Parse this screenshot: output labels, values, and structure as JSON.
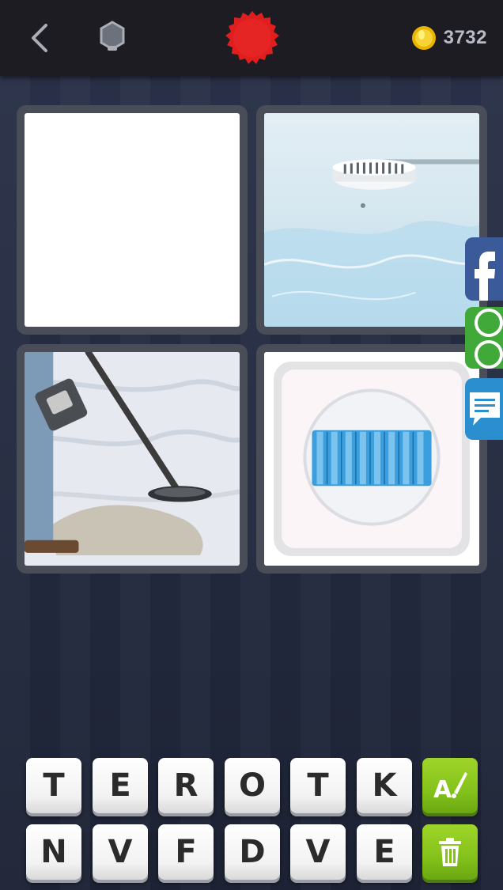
{
  "header": {
    "back_icon": "chevron-left-icon",
    "hint_icon": "hexagon-icon",
    "level_badge_color": "#e01e1e",
    "coin_icon": "gold-coin-icon",
    "coins": "3732"
  },
  "pictures": [
    {
      "description": "blank white picture"
    },
    {
      "description": "smoke detector on frosty ceiling"
    },
    {
      "description": "metal detector on sand"
    },
    {
      "description": "radiator / heater icon"
    }
  ],
  "share": {
    "facebook_icon": "facebook-icon",
    "whatsapp_icon": "whatsapp-icon",
    "sms_icon": "message-icon"
  },
  "letters": {
    "row1": [
      "T",
      "E",
      "R",
      "O",
      "T",
      "K"
    ],
    "row2": [
      "N",
      "V",
      "F",
      "D",
      "V",
      "E"
    ]
  },
  "actions": {
    "hint_letter_icon": "magic-brush-icon",
    "remove_letters_icon": "trash-icon",
    "accent_color": "#8cc61e"
  }
}
